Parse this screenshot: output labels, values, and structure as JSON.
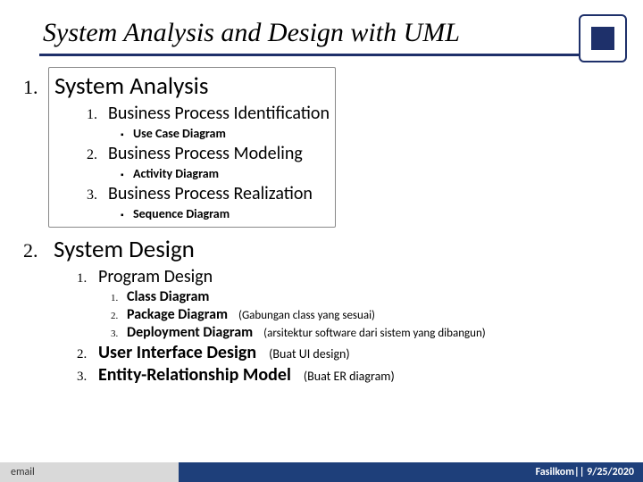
{
  "title": "System Analysis and Design with UML",
  "sections": {
    "s1": {
      "num": "1.",
      "label": "System Analysis",
      "items": {
        "i1": {
          "num": "1.",
          "label": "Business Process Identification",
          "sub": {
            "b": "▪",
            "label": "Use Case Diagram"
          }
        },
        "i2": {
          "num": "2.",
          "label": "Business Process Modeling",
          "sub": {
            "b": "▪",
            "label": "Activity Diagram"
          }
        },
        "i3": {
          "num": "3.",
          "label": "Business Process Realization",
          "sub": {
            "b": "▪",
            "label": "Sequence Diagram"
          }
        }
      }
    },
    "s2": {
      "num": "2.",
      "label": "System Design",
      "items": {
        "i1": {
          "num": "1.",
          "label": "Program Design",
          "subs": {
            "a": {
              "num": "1.",
              "label": "Class Diagram",
              "ann": ""
            },
            "b": {
              "num": "2.",
              "label": "Package Diagram",
              "ann": "(Gabungan class yang sesuai)"
            },
            "c": {
              "num": "3.",
              "label": "Deployment Diagram",
              "ann": "(arsitektur software dari sistem yang dibangun)"
            }
          }
        },
        "i2": {
          "num": "2.",
          "label": "User Interface Design",
          "ann": "(Buat UI design)"
        },
        "i3": {
          "num": "3.",
          "label": "Entity-Relationship Model",
          "ann": "(Buat ER diagram)"
        }
      }
    }
  },
  "footer": {
    "left": "email",
    "right": "Fasilkom|| 9/25/2020"
  }
}
